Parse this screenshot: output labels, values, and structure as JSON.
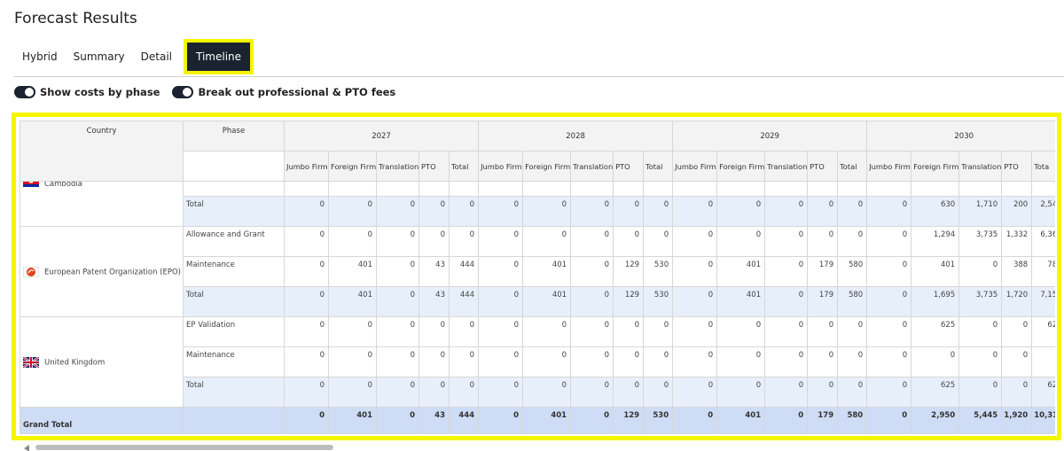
{
  "page": {
    "title": "Forecast Results"
  },
  "tabs": [
    {
      "label": "Hybrid"
    },
    {
      "label": "Summary"
    },
    {
      "label": "Detail"
    },
    {
      "label": "Timeline"
    }
  ],
  "toggles": [
    {
      "label": "Show costs by phase",
      "on": true
    },
    {
      "label": "Break out professional & PTO fees",
      "on": true
    }
  ],
  "table": {
    "col_country": "Country",
    "col_phase": "Phase",
    "years": [
      "2027",
      "2028",
      "2029",
      "2030"
    ],
    "subcols": [
      "Jumbo Firm",
      "Foreign Firm",
      "Translation",
      "PTO",
      "Total"
    ],
    "last_subcol_visible": "Tota",
    "rows": [
      {
        "country": "Cambodia",
        "country_visible": "Cambodia",
        "flag": "cambodia-flag",
        "phase": "",
        "vals": [
          "",
          "",
          "",
          "",
          "",
          "",
          "",
          "",
          "",
          "",
          "",
          "",
          "",
          "",
          "",
          "",
          "",
          "",
          "",
          ""
        ],
        "kind": "cut"
      },
      {
        "country": "",
        "phase": "Total",
        "kind": "total",
        "vals": [
          "0",
          "0",
          "0",
          "0",
          "0",
          "0",
          "0",
          "0",
          "0",
          "0",
          "0",
          "0",
          "0",
          "0",
          "0",
          "0",
          "630",
          "1,710",
          "200",
          "2,54"
        ]
      },
      {
        "country": "European Patent Organization (EPO)",
        "flag": "epo-flag",
        "phase": "Allowance and Grant",
        "kind": "data",
        "vals": [
          "0",
          "0",
          "0",
          "0",
          "0",
          "0",
          "0",
          "0",
          "0",
          "0",
          "0",
          "0",
          "0",
          "0",
          "0",
          "0",
          "1,294",
          "3,735",
          "1,332",
          "6,36"
        ]
      },
      {
        "country": "",
        "phase": "Maintenance",
        "kind": "data",
        "vals": [
          "0",
          "401",
          "0",
          "43",
          "444",
          "0",
          "401",
          "0",
          "129",
          "530",
          "0",
          "401",
          "0",
          "179",
          "580",
          "0",
          "401",
          "0",
          "388",
          "78"
        ]
      },
      {
        "country": "",
        "phase": "Total",
        "kind": "total",
        "vals": [
          "0",
          "401",
          "0",
          "43",
          "444",
          "0",
          "401",
          "0",
          "129",
          "530",
          "0",
          "401",
          "0",
          "179",
          "580",
          "0",
          "1,695",
          "3,735",
          "1,720",
          "7,15"
        ]
      },
      {
        "country": "United Kingdom",
        "flag": "uk-flag",
        "phase": "EP Validation",
        "kind": "data",
        "vals": [
          "0",
          "0",
          "0",
          "0",
          "0",
          "0",
          "0",
          "0",
          "0",
          "0",
          "0",
          "0",
          "0",
          "0",
          "0",
          "0",
          "625",
          "0",
          "0",
          "62"
        ]
      },
      {
        "country": "",
        "phase": "Maintenance",
        "kind": "data",
        "vals": [
          "0",
          "0",
          "0",
          "0",
          "0",
          "0",
          "0",
          "0",
          "0",
          "0",
          "0",
          "0",
          "0",
          "0",
          "0",
          "0",
          "0",
          "0",
          "0",
          ""
        ]
      },
      {
        "country": "",
        "phase": "Total",
        "kind": "total",
        "vals": [
          "0",
          "0",
          "0",
          "0",
          "0",
          "0",
          "0",
          "0",
          "0",
          "0",
          "0",
          "0",
          "0",
          "0",
          "0",
          "0",
          "625",
          "0",
          "0",
          "62"
        ]
      }
    ],
    "grand_total": {
      "label": "Grand Total",
      "vals": [
        "0",
        "401",
        "0",
        "43",
        "444",
        "0",
        "401",
        "0",
        "129",
        "530",
        "0",
        "401",
        "0",
        "179",
        "580",
        "0",
        "2,950",
        "5,445",
        "1,920",
        "10,31"
      ]
    }
  },
  "colors": {
    "accent_dark": "#1b2330",
    "highlight": "#f5f500",
    "total_row": "#e7effb",
    "grand_row": "#cfdcf5"
  }
}
